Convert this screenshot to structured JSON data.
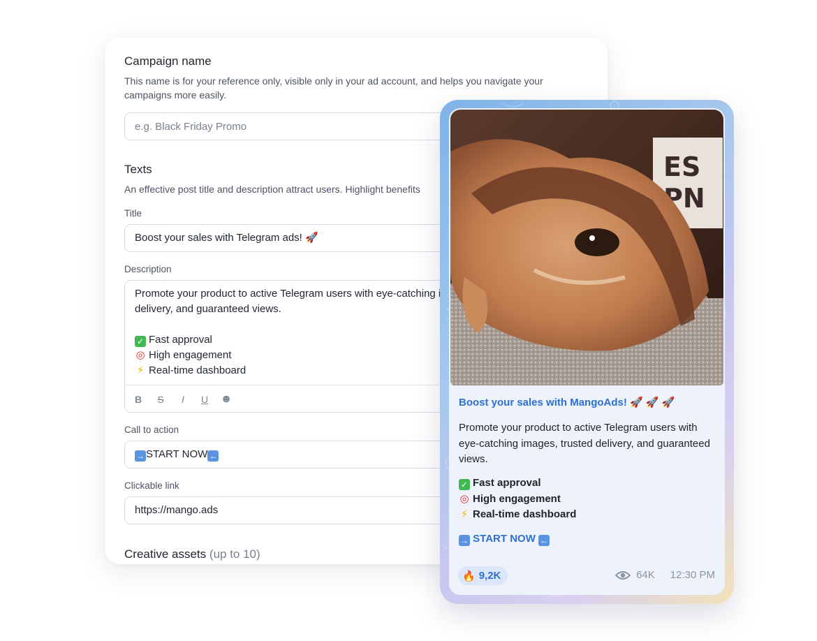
{
  "form": {
    "campaign": {
      "title": "Campaign name",
      "description": "This name is for your reference only, visible only in your ad account, and helps you navigate your campaigns more easily.",
      "placeholder": "e.g. Black Friday Promo"
    },
    "texts": {
      "title": "Texts",
      "description": "An effective post title and description attract users. Highlight benefits",
      "title_label": "Title",
      "title_value": "Boost your sales with Telegram ads! 🚀",
      "description_label": "Description",
      "description_lines": [
        "Promote your product to active Telegram users with eye-catching images, trusted",
        "delivery, and guaranteed views."
      ],
      "bullets": [
        "Fast approval",
        "High engagement",
        "Real-time dashboard"
      ],
      "bullet_icons": [
        "check-icon",
        "target-icon",
        "lightning-icon"
      ]
    },
    "toolbar": [
      "B",
      "S",
      "I",
      "U",
      "☻"
    ],
    "cta": {
      "label": "Call to action",
      "value": "START NOW"
    },
    "link": {
      "label": "Clickable link",
      "value": "https://mango.ads"
    },
    "assets": {
      "title": "Creative assets",
      "hint": "(up to 10)"
    }
  },
  "preview": {
    "title": "Boost your sales with MangoAds! 🚀 🚀 🚀",
    "body": "Promote your product to active Telegram users with eye-catching images, trusted delivery, and guaranteed views.",
    "bullets": [
      "Fast approval",
      "High engagement",
      "Real-time dashboard"
    ],
    "cta": "START NOW",
    "reaction_count": "9,2K",
    "views": "64K",
    "time": "12:30 PM"
  },
  "colors": {
    "accent": "#2f6fd0",
    "frame_gradient_start": "#7fb3e8",
    "frame_gradient_end": "#f2e3b8",
    "bubble": "#eef3fb"
  }
}
